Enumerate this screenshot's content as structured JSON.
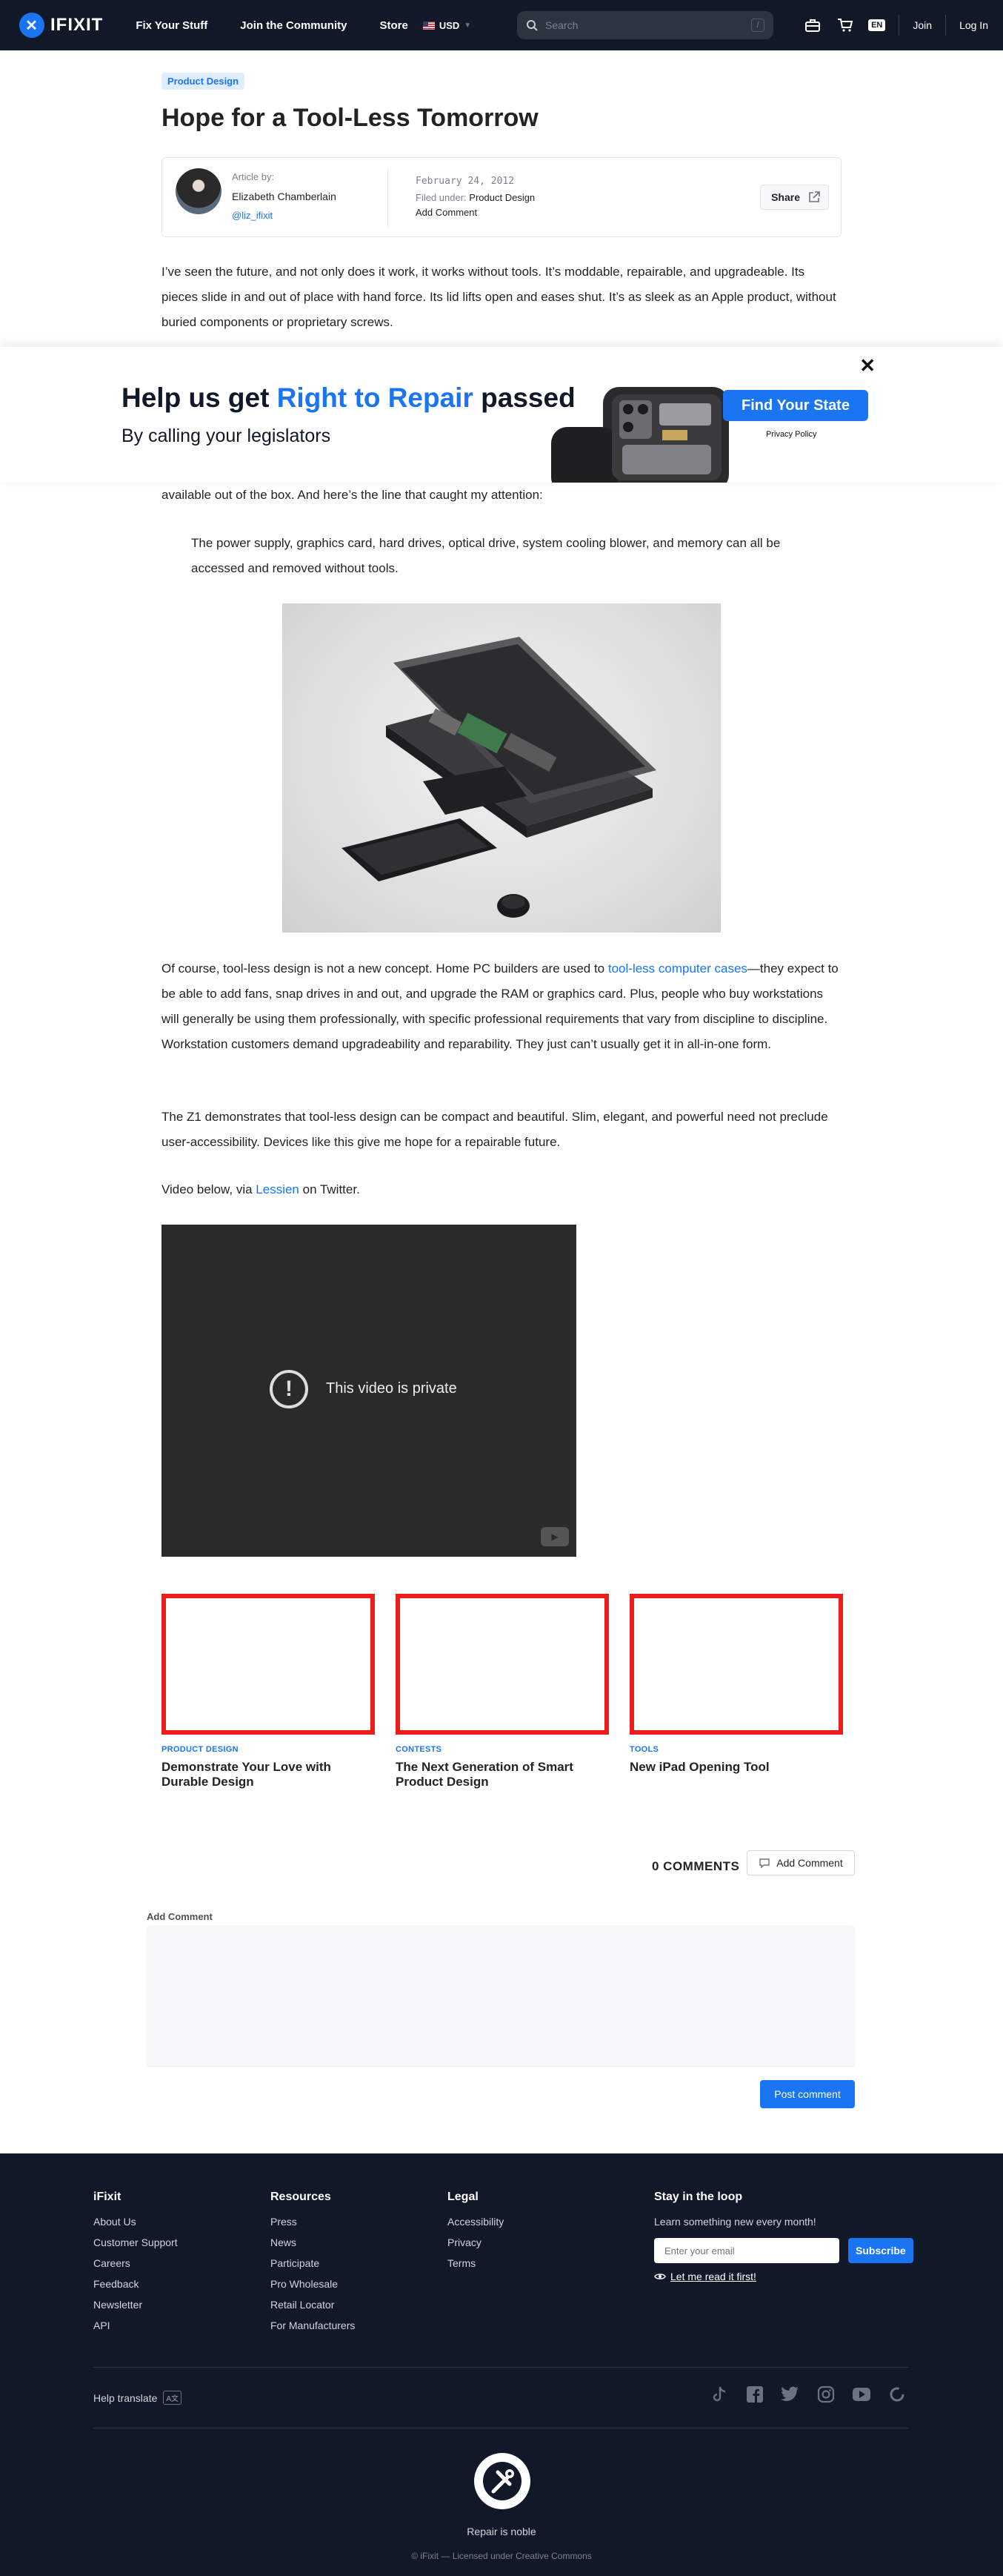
{
  "nav": {
    "brand": "IFIXIT",
    "links": [
      "Fix Your Stuff",
      "Join the Community",
      "Store"
    ],
    "currency": "USD",
    "search_placeholder": "Search",
    "search_shortcut": "/",
    "lang": "EN",
    "join": "Join",
    "login": "Log In"
  },
  "article": {
    "tag": "Product Design",
    "title": "Hope for a Tool-Less Tomorrow",
    "author_label": "Article by:",
    "author_name": "Elizabeth Chamberlain",
    "author_handle": "@liz_ifixit",
    "date": "February 24, 2012",
    "filed_label": "Filed under:",
    "filed_value": "Product Design",
    "add_comment": "Add Comment",
    "share": "Share",
    "intro": "I’ve seen the future, and not only does it work, it works without tools. It’s moddable, repairable, and upgradeable. Its pieces slide in and out of place with hand force. Its lid lifts open and eases shut. It’s as sleek as an Apple product, without buried components or proprietary screws.",
    "p_fragment": "available out of the box. And here’s the line that caught my attention:",
    "quote": "The power supply, graphics card, hard drives, optical drive, system cooling blower, and memory can all be accessed and removed without tools.",
    "p3_before": "Of course, tool-less design is not a new concept. Home PC builders are used to ",
    "p3_link": "tool-less computer cases",
    "p3_after": "—they expect to be able to add fans, snap drives in and out, and upgrade the RAM or graphics card. Plus, people who buy workstations will generally be using them professionally, with specific professional requirements that vary from discipline to discipline. Workstation customers demand upgradeability and reparability. They just can’t usually get it in all-in-one form.",
    "p4": "The Z1 demonstrates that tool-less design can be compact and beautiful. Slim, elegant, and powerful need not preclude user-accessibility. Devices like this give me hope for a repairable future.",
    "p5_before": "Video below, via ",
    "p5_link": "Lessien",
    "p5_after": " on Twitter."
  },
  "banner": {
    "headline_pre": "Help us get ",
    "headline_accent": "Right to Repair",
    "headline_post": " passed",
    "subline": "By calling your legislators",
    "cta": "Find Your State",
    "privacy": "Privacy Policy",
    "close": "✕"
  },
  "video": {
    "message": "This video is private",
    "icon": "!"
  },
  "related": [
    {
      "category": "PRODUCT DESIGN",
      "title": "Demonstrate Your Love with Durable Design"
    },
    {
      "category": "CONTESTS",
      "title": "The Next Generation of Smart Product Design"
    },
    {
      "category": "TOOLS",
      "title": "New iPad Opening Tool"
    }
  ],
  "comments": {
    "count_label": "0 COMMENTS",
    "add_button": "Add Comment",
    "form_label": "Add Comment",
    "post_button": "Post comment"
  },
  "footer": {
    "ifixit": {
      "head": "iFixit",
      "links": [
        "About Us",
        "Customer Support",
        "Careers",
        "Feedback",
        "Newsletter",
        "API"
      ]
    },
    "resources": {
      "head": "Resources",
      "links": [
        "Press",
        "News",
        "Participate",
        "Pro Wholesale",
        "Retail Locator",
        "For Manufacturers"
      ]
    },
    "legal": {
      "head": "Legal",
      "links": [
        "Accessibility",
        "Privacy",
        "Terms"
      ]
    },
    "stay": {
      "head": "Stay in the loop",
      "text": "Learn something new every month!",
      "email_placeholder": "Enter your email",
      "subscribe": "Subscribe",
      "read_first": "Let me read it first!"
    },
    "help_translate": "Help translate",
    "tagline": "Repair is noble",
    "copyright": "© iFixit — Licensed under Creative Commons"
  },
  "colors": {
    "accent": "#1975f2",
    "nav_bg": "#111827",
    "card_border": "#ee1c1c"
  }
}
